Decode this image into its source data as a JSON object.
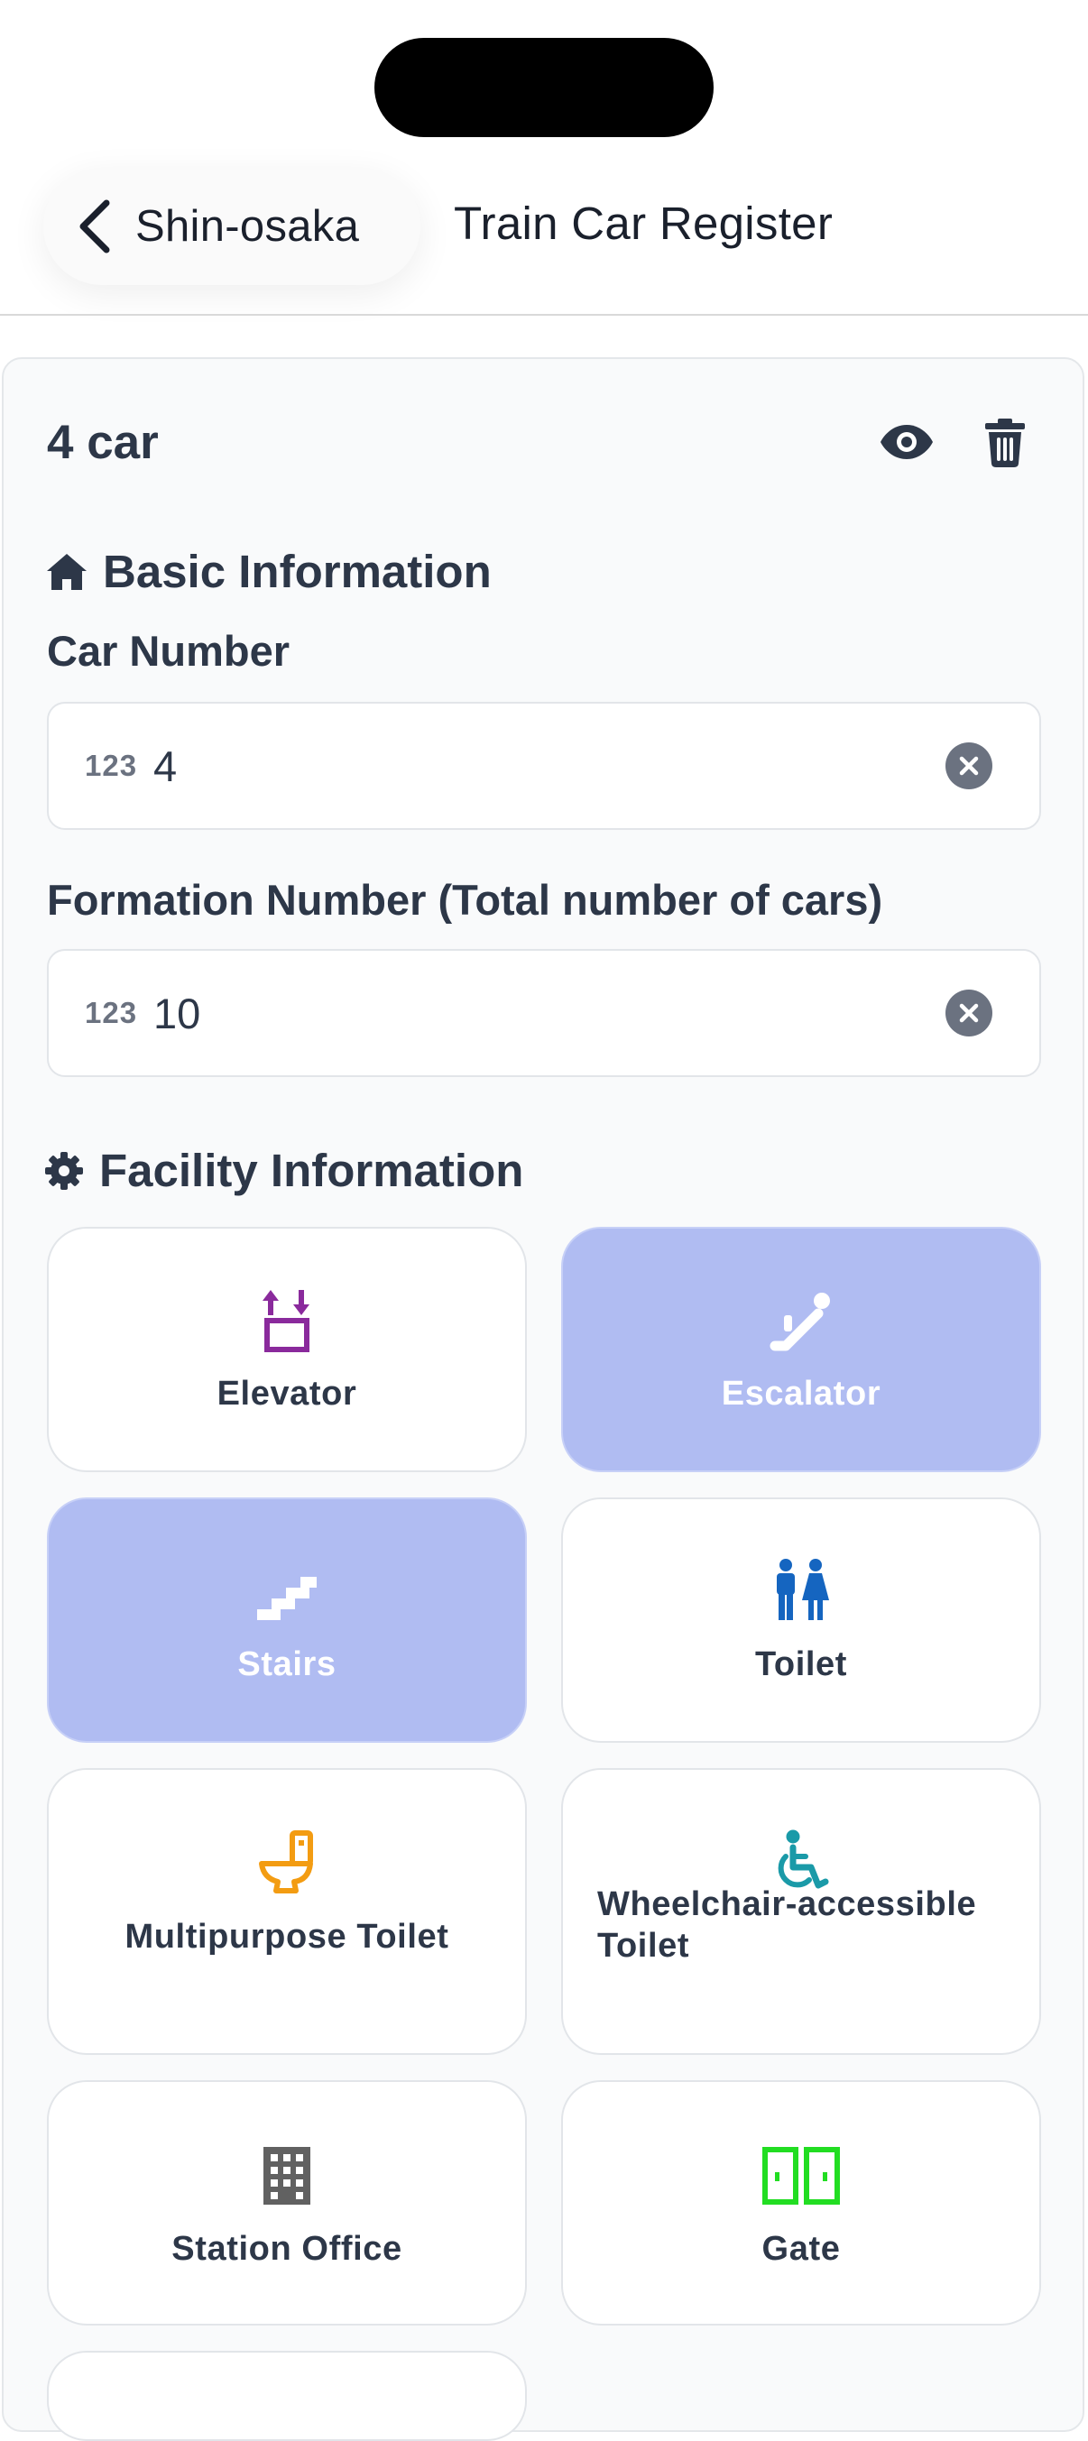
{
  "header": {
    "back_label": "Shin-osaka",
    "title": "Train Car Register"
  },
  "card": {
    "title": "4 car"
  },
  "basic": {
    "section_title": "Basic Information",
    "car_number": {
      "label": "Car Number",
      "prefix": "123",
      "value": "4"
    },
    "formation_number": {
      "label": "Formation Number (Total number of cars)",
      "prefix": "123",
      "value": "10"
    }
  },
  "facility": {
    "section_title": "Facility Information",
    "items": [
      {
        "label": "Elevator",
        "icon": "elevator-icon",
        "color": "#8a2a9c",
        "selected": false
      },
      {
        "label": "Escalator",
        "icon": "escalator-icon",
        "color": "#ffffff",
        "selected": true
      },
      {
        "label": "Stairs",
        "icon": "stairs-icon",
        "color": "#ffffff",
        "selected": true
      },
      {
        "label": "Toilet",
        "icon": "toilet-people-icon",
        "color": "#1565c0",
        "selected": false
      },
      {
        "label": "Multipurpose Toilet",
        "icon": "toilet-icon",
        "color": "#f39c12",
        "selected": false
      },
      {
        "label": "Wheelchair-accessible Toilet",
        "icon": "wheelchair-icon",
        "color": "#1a9aa8",
        "selected": false
      },
      {
        "label": "Station Office",
        "icon": "building-icon",
        "color": "#616161",
        "selected": false
      },
      {
        "label": "Gate",
        "icon": "gate-icon",
        "color": "#22dd22",
        "selected": false
      }
    ]
  },
  "colors": {
    "selected_tile": "#b0bcf2",
    "text_primary": "#2d3748",
    "icon_gray": "#6b7280"
  }
}
